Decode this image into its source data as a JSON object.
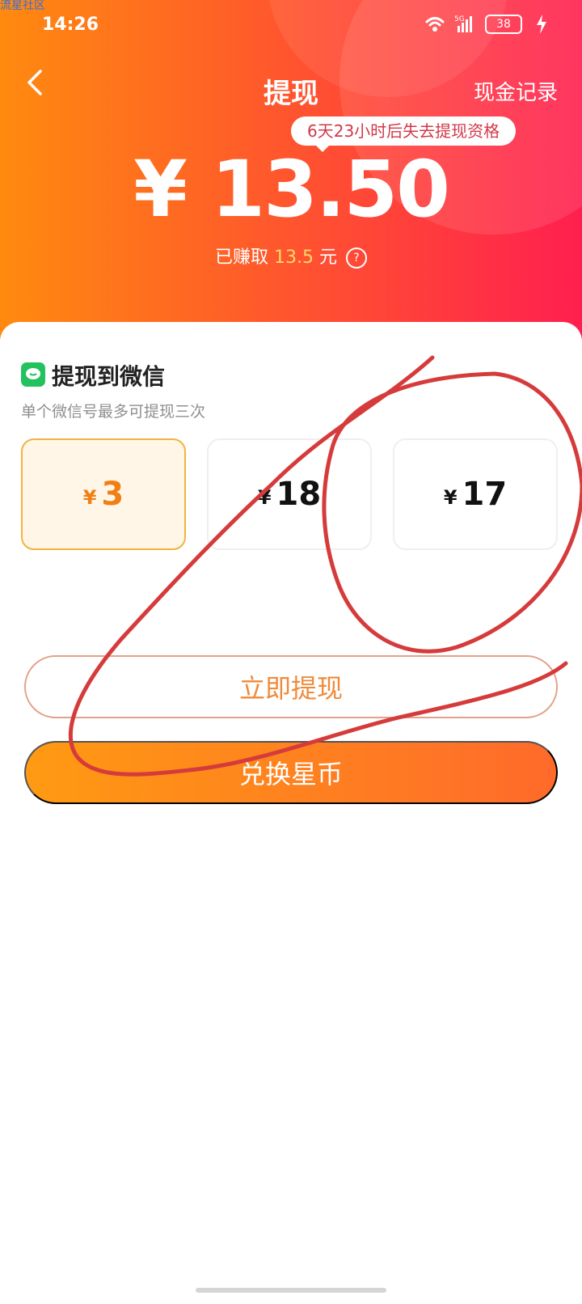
{
  "watermark": "流星社区",
  "status_bar": {
    "time": "14:26",
    "battery": "38",
    "icons": [
      "wifi-icon",
      "signal-5g-icon",
      "battery-icon",
      "charging-bolt-icon"
    ],
    "network": "5G"
  },
  "header": {
    "title": "提现",
    "right_link": "现金记录",
    "deadline_notice": "6天23小时后失去提现资格",
    "balance": "¥ 13.50",
    "earned_prefix": "已赚取",
    "earned_value": "13.5",
    "earned_suffix": "元",
    "help_icon": "?"
  },
  "wallet": {
    "title": "提现到微信",
    "subtitle": "单个微信号最多可提现三次",
    "options": [
      {
        "currency": "¥",
        "amount": "3",
        "selected": true
      },
      {
        "currency": "¥",
        "amount": "18",
        "selected": false
      },
      {
        "currency": "¥",
        "amount": "17",
        "selected": false
      }
    ],
    "withdraw_button": "立即提现",
    "exchange_button": "兑换星币"
  },
  "colors": {
    "header_gradient_start": "#ff8a0f",
    "header_gradient_end": "#ff1f4f",
    "selected_orange": "#f07f14",
    "selected_border": "#f0b33f",
    "wechat_green": "#24c15f",
    "annotation_red": "#d63b3b"
  }
}
